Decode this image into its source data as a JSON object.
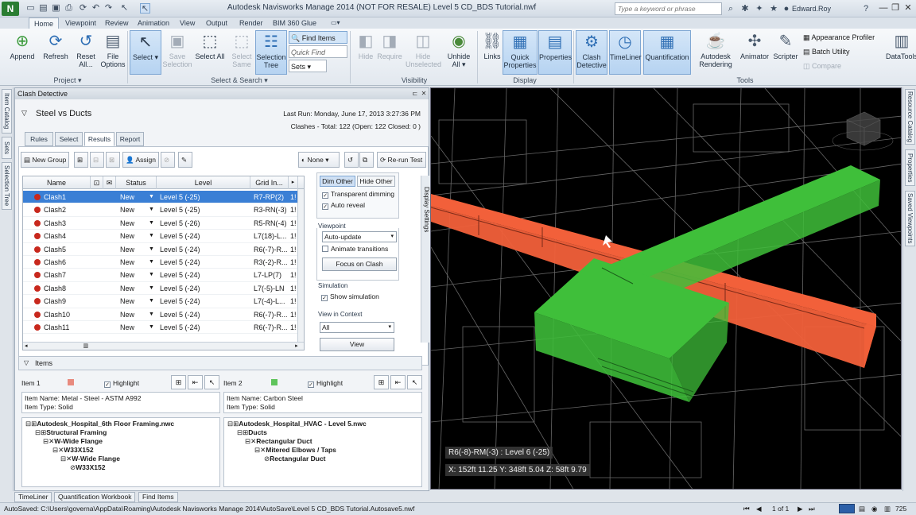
{
  "window": {
    "title": "Autodesk Navisworks Manage 2014 (NOT FOR RESALE)    Level 5 CD_BDS Tutorial.nwf",
    "search_placeholder": "Type a keyword or phrase",
    "user": "Edward.Roy",
    "logo": "N"
  },
  "ribbon_tabs": [
    "Home",
    "Viewpoint",
    "Review",
    "Animation",
    "View",
    "Output",
    "Render",
    "BIM 360 Glue"
  ],
  "project": {
    "append": "Append",
    "refresh": "Refresh",
    "reset_all": "Reset All...",
    "file_options": "File Options",
    "group": "Project ▾"
  },
  "select_search": {
    "select": "Select",
    "save_selection": "Save Selection",
    "select_all": "Select All",
    "select_same": "Select Same",
    "selection_tree": "Selection Tree",
    "find_items": "Find Items",
    "quick_find_placeholder": "Quick Find",
    "sets": "Sets",
    "group": "Select & Search ▾"
  },
  "visibility": {
    "hide": "Hide",
    "require": "Require",
    "hide_unselected": "Hide Unselected",
    "unhide_all": "Unhide All",
    "group": "Visibility"
  },
  "display": {
    "links": "Links",
    "quick_properties": "Quick Properties",
    "properties": "Properties",
    "group": "Display"
  },
  "tools": {
    "clash_detective": "Clash Detective",
    "timeliner": "TimeLiner",
    "quantification": "Quantification",
    "autodesk_rendering": "Autodesk Rendering",
    "animator": "Animator",
    "scripter": "Scripter",
    "appearance_profiler": "Appearance Profiler",
    "batch_utility": "Batch Utility",
    "compare": "Compare",
    "datatools": "DataTools",
    "group": "Tools"
  },
  "left_tabs": [
    "Item Catalog",
    "Sets",
    "Selection Tree"
  ],
  "right_tabs": [
    "Resource Catalog",
    "Properties",
    "Saved Viewpoints"
  ],
  "clash": {
    "panel_title": "Clash Detective",
    "test_name": "Steel vs Ducts",
    "last_run": "Last Run:  Monday, June 17, 2013 3:27:36 PM",
    "summary": "Clashes -  Total: 122  (Open: 122  Closed: 0 )",
    "tabs": [
      "Rules",
      "Select",
      "Results",
      "Report"
    ],
    "toolbar": {
      "new_group": "New Group",
      "assign": "Assign",
      "none": "None",
      "rerun": "Re-run Test"
    },
    "columns": [
      "Name",
      "Status",
      "Level",
      "Grid In..."
    ],
    "rows": [
      {
        "name": "Clash1",
        "status": "New",
        "level": "Level 5 (-25)",
        "grid": "R7-RP(2)",
        "extra": "1!"
      },
      {
        "name": "Clash2",
        "status": "New",
        "level": "Level 5 (-25)",
        "grid": "R3-RN(-3)",
        "extra": "1!"
      },
      {
        "name": "Clash3",
        "status": "New",
        "level": "Level 5 (-26)",
        "grid": "R5-RN(-4)",
        "extra": "1!"
      },
      {
        "name": "Clash4",
        "status": "New",
        "level": "Level 5 (-24)",
        "grid": "L7(18)-L...",
        "extra": "1!"
      },
      {
        "name": "Clash5",
        "status": "New",
        "level": "Level 5 (-24)",
        "grid": "R6(-7)-R...",
        "extra": "1!"
      },
      {
        "name": "Clash6",
        "status": "New",
        "level": "Level 5 (-24)",
        "grid": "R3(-2)-R...",
        "extra": "1!"
      },
      {
        "name": "Clash7",
        "status": "New",
        "level": "Level 5 (-24)",
        "grid": "L7-LP(7)",
        "extra": "1!"
      },
      {
        "name": "Clash8",
        "status": "New",
        "level": "Level 5 (-24)",
        "grid": "L7(-5)-LN",
        "extra": "1!"
      },
      {
        "name": "Clash9",
        "status": "New",
        "level": "Level 5 (-24)",
        "grid": "L7(-4)-L...",
        "extra": "1!"
      },
      {
        "name": "Clash10",
        "status": "New",
        "level": "Level 5 (-24)",
        "grid": "R6(-7)-R...",
        "extra": "1!"
      },
      {
        "name": "Clash11",
        "status": "New",
        "level": "Level 5 (-24)",
        "grid": "R6(-7)-R...",
        "extra": "1!"
      }
    ],
    "display": {
      "dim_other": "Dim Other",
      "hide_other": "Hide Other",
      "transparent_dimming": "Transparent dimming",
      "auto_reveal": "Auto reveal",
      "viewpoint_caption": "Viewpoint",
      "viewpoint_value": "Auto-update",
      "animate_transitions": "Animate transitions",
      "focus": "Focus on Clash",
      "simulation_caption": "Simulation",
      "show_simulation": "Show simulation",
      "view_in_context_caption": "View in Context",
      "view_in_context_value": "All",
      "view": "View",
      "side_label": "Display Settings"
    },
    "items_label": "Items",
    "item1": {
      "label": "Item 1",
      "highlight": "Highlight",
      "name": "Item Name: Metal - Steel - ASTM A992",
      "type": "Item Type: Solid",
      "color": "#e88a7e",
      "tree": [
        "Autodesk_Hospital_6th Floor Framing.nwc",
        "Structural Framing",
        "W-Wide Flange",
        "W33X152",
        "W-Wide Flange",
        "W33X152"
      ]
    },
    "item2": {
      "label": "Item 2",
      "highlight": "Highlight",
      "name": "Item Name: Carbon Steel",
      "type": "Item Type: Solid",
      "color": "#5fc45c",
      "tree": [
        "Autodesk_Hospital_HVAC - Level 5.nwc",
        "Ducts",
        "Rectangular Duct",
        "Mitered Elbows / Taps",
        "Rectangular Duct"
      ]
    }
  },
  "bottom_tabs": [
    "TimeLiner",
    "Quantification Workbook",
    "Find Items"
  ],
  "status": {
    "text": "AutoSaved: C:\\Users\\governa\\AppData\\Roaming\\Autodesk Navisworks Manage 2014\\AutoSave\\Level 5 CD_BDS Tutorial.Autosave5.nwf",
    "page": "1 of 1",
    "memory": "725"
  },
  "viewport": {
    "grid_location": "R6(-8)-RM(-3) : Level 6 (-25)",
    "coordinates": "X: 152ft 11.25  Y: 348ft 5.04  Z: 58ft 9.79",
    "steel_color": "#f2603a",
    "duct_color": "#3fbf3a"
  }
}
